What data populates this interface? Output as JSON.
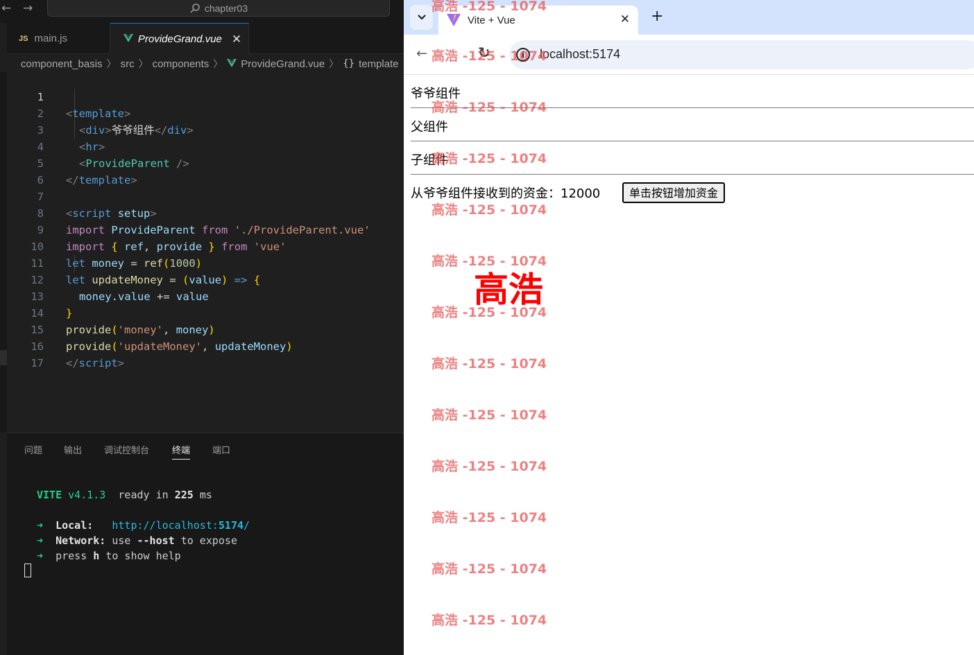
{
  "editor": {
    "search_text": "chapter03",
    "tabs": [
      {
        "badge": "JS",
        "label": "main.js"
      },
      {
        "label": "ProvideGrand.vue",
        "close": "✕"
      }
    ],
    "breadcrumb": [
      "component_basis",
      "src",
      "components",
      "ProvideGrand.vue",
      "template"
    ],
    "breadcrumb_braces": "{}",
    "line_numbers": [
      "1",
      "2",
      "3",
      "4",
      "5",
      "6",
      "7",
      "8",
      "9",
      "10",
      "11",
      "12",
      "13",
      "14",
      "15",
      "16",
      "17"
    ],
    "code": {
      "l1_tag": "template",
      "l2_tag": "div",
      "l2_text": "爷爷组件",
      "l2_close": "div",
      "l3_tag": "hr",
      "l4_tag": "ProvideParent",
      "l5_tag": "template",
      "l7_tag": "script",
      "l7_attr": "setup",
      "l8_kw": "import",
      "l8_name": "ProvideParent",
      "l8_from": "from",
      "l8_str": "'./ProvideParent.vue'",
      "l9_kw": "import",
      "l9_a": "ref",
      "l9_b": "provide",
      "l9_from": "from",
      "l9_str": "'vue'",
      "l10_let": "let",
      "l10_var": "money",
      "l10_fn": "ref",
      "l10_num": "1000",
      "l11_let": "let",
      "l11_fn": "updateMoney",
      "l11_param": "value",
      "l12_obj": "money",
      "l12_prop": "value",
      "l12_op": "+=",
      "l12_val": "value",
      "l14_fn": "provide",
      "l14_str": "'money'",
      "l14_var": "money",
      "l15_fn": "provide",
      "l15_str": "'updateMoney'",
      "l15_var": "updateMoney",
      "l16_tag": "script"
    },
    "panel_tabs": [
      "问题",
      "输出",
      "调试控制台",
      "终端",
      "端口"
    ],
    "terminal": {
      "vite": "VITE",
      "version": "v4.1.3",
      "ready": "ready in",
      "ms_value": "225",
      "ms_unit": "ms",
      "arrow": "➜",
      "local_label": "Local:",
      "local_url_prefix": "http://localhost:",
      "local_port": "5174",
      "local_slash": "/",
      "network_label": "Network:",
      "network_use": "use",
      "network_flag": "--host",
      "network_rest": "to expose",
      "press": "press",
      "press_key": "h",
      "press_rest": "to show help"
    }
  },
  "browser": {
    "tab_title": "Vite + Vue",
    "tab_close": "✕",
    "new_tab": "+",
    "url": "localhost:5174",
    "page": {
      "grand": "爷爷组件",
      "parent": "父组件",
      "child": "子组件",
      "received_label": "从爷爷组件接收到的资金：",
      "amount": "12000",
      "button": "单击按钮增加资金"
    },
    "watermark": "高浩 -125 - 1074",
    "watermark_big": "高浩"
  },
  "colors": {
    "editor_bg": "#1f1f1f",
    "accent": "#0078d4",
    "vite_green": "#23d18b",
    "watermark": "#e65050",
    "browser_tabstrip": "#d3e3fd"
  },
  "icons": [
    "back-arrow-icon",
    "forward-arrow-icon",
    "search-icon",
    "vue-file-icon",
    "close-icon",
    "chevron-down-icon",
    "reload-icon",
    "info-icon",
    "new-tab-icon"
  ]
}
